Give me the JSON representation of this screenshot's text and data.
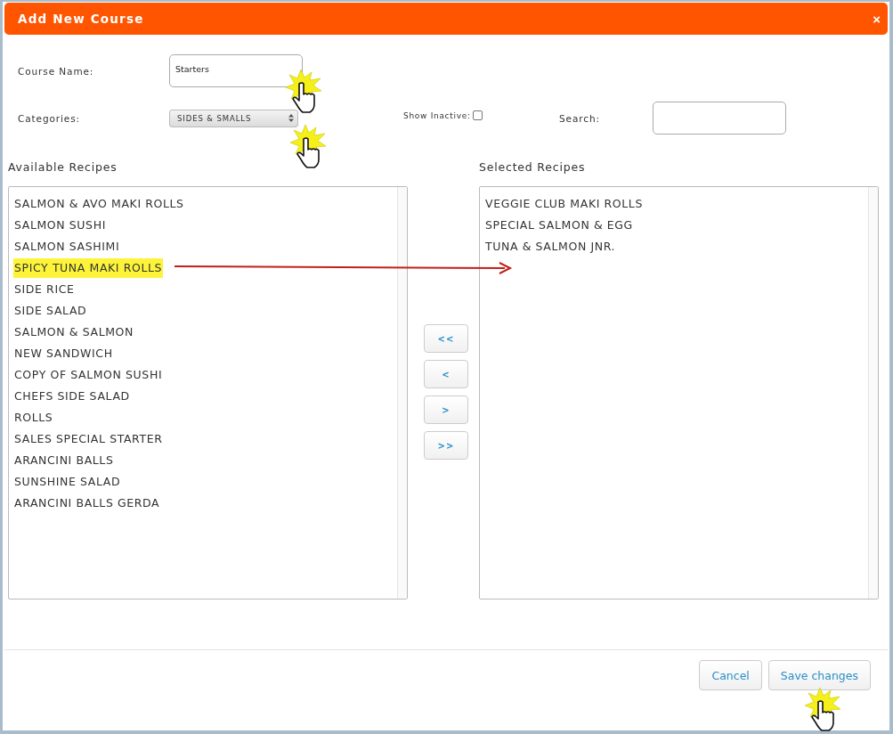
{
  "dialog": {
    "title": "Add New Course",
    "close": "×"
  },
  "course_name": {
    "label": "Course Name:",
    "value": "Starters"
  },
  "categories": {
    "label": "Categories:",
    "value": "SIDES & SMALLS"
  },
  "show_inactive": {
    "label": "Show Inactive:",
    "checked": false
  },
  "search": {
    "label": "Search:"
  },
  "available": {
    "heading": "Available Recipes",
    "items": [
      {
        "name": "SALMON & AVO MAKI ROLLS",
        "highlighted": false
      },
      {
        "name": "SALMON SUSHI",
        "highlighted": false
      },
      {
        "name": "SALMON SASHIMI",
        "highlighted": false
      },
      {
        "name": "SPICY TUNA MAKI ROLLS",
        "highlighted": true
      },
      {
        "name": "SIDE RICE",
        "highlighted": false
      },
      {
        "name": "SIDE SALAD",
        "highlighted": false
      },
      {
        "name": "SALMON & SALMON",
        "highlighted": false
      },
      {
        "name": "NEW SANDWICH",
        "highlighted": false
      },
      {
        "name": "COPY OF SALMON SUSHI",
        "highlighted": false
      },
      {
        "name": "CHEFS SIDE SALAD",
        "highlighted": false
      },
      {
        "name": "ROLLS",
        "highlighted": false
      },
      {
        "name": "SALES SPECIAL STARTER",
        "highlighted": false
      },
      {
        "name": "ARANCINI BALLS",
        "highlighted": false
      },
      {
        "name": "SUNSHINE SALAD",
        "highlighted": false
      },
      {
        "name": "ARANCINI BALLS GERDA",
        "highlighted": false
      }
    ]
  },
  "selected_recipes": {
    "heading": "Selected Recipes",
    "items": [
      {
        "name": "VEGGIE CLUB MAKI ROLLS",
        "highlighted": false
      },
      {
        "name": "SPECIAL SALMON & EGG",
        "highlighted": false
      },
      {
        "name": "TUNA & SALMON JNR.",
        "highlighted": false
      }
    ]
  },
  "move_buttons": [
    "<<",
    "<",
    ">",
    ">>"
  ],
  "footer_buttons": [
    "Cancel",
    "Save changes"
  ]
}
